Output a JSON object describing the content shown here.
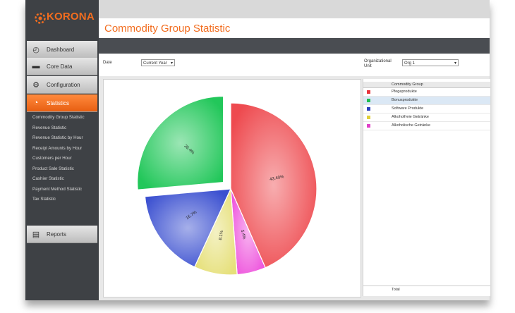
{
  "logo": {
    "text": "KORONA"
  },
  "nav": {
    "dashboard": "Dashboard",
    "core_data": "Core Data",
    "configuration": "Configuration",
    "statistics": "Statistics",
    "reports": "Reports"
  },
  "submenu": [
    "Commodity Group Statistic",
    "Revenue Statistic",
    "Revenue Statistic by Hour",
    "Receipt Amounts by Hour",
    "Customers per Hour",
    "Product Sale Statistic",
    "Cashier Statistic",
    "Payment Method Statistic",
    "Tax Statistic"
  ],
  "page": {
    "title": "Commodity Group Statistic"
  },
  "filters": {
    "date_label": "Date",
    "date_value": "Current Year",
    "org_label_1": "Organizational",
    "org_label_2": "Unit",
    "org_value": "Org 1"
  },
  "legend": {
    "header": "Commodity Group",
    "rows": [
      {
        "name": "Pfegeprodukte",
        "color": "#e8323a"
      },
      {
        "name": "Bonusprodukte",
        "color": "#1fbf4f"
      },
      {
        "name": "Software Produkte",
        "color": "#2b3fbf"
      },
      {
        "name": "Alkoholfreie Getränke",
        "color": "#e0cf3a"
      },
      {
        "name": "Alkoholische Getränke",
        "color": "#e040c8"
      }
    ],
    "total": "Total"
  },
  "chart_data": {
    "type": "pie",
    "slices": [
      {
        "label": "43.40%",
        "value": 43.4,
        "color": "#ee4a4f",
        "exploded": false
      },
      {
        "label": "5.4%",
        "value": 5.4,
        "color": "#ee55dd",
        "exploded": false
      },
      {
        "label": "8.1%",
        "value": 8.1,
        "color": "#e6e07a",
        "exploded": false
      },
      {
        "label": "16.7%",
        "value": 16.7,
        "color": "#3a4fd0",
        "exploded": false
      },
      {
        "label": "26.4%",
        "value": 26.4,
        "color": "#22c75a",
        "exploded": true
      }
    ]
  }
}
